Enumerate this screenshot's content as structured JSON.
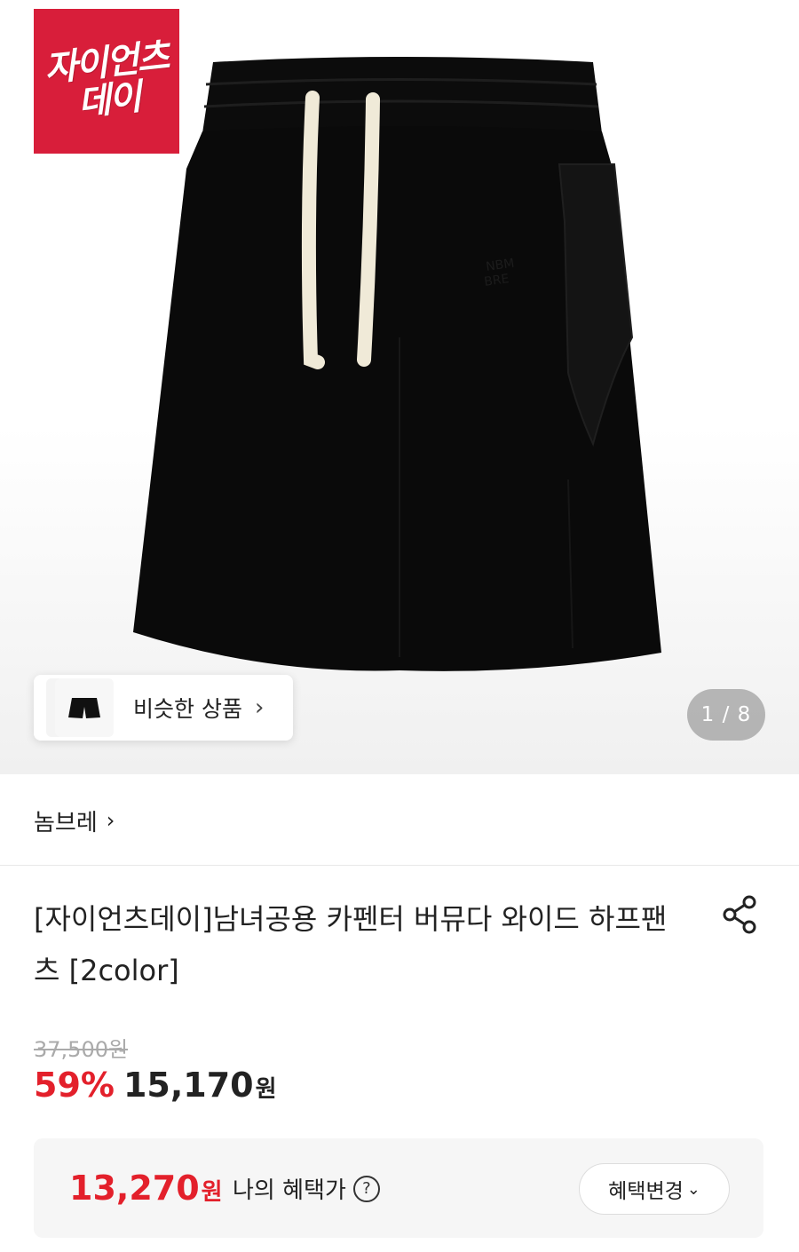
{
  "product_image": {
    "brand_logo_text": [
      "자이언츠",
      "데이"
    ],
    "similar_products_label": "비슷한 상품",
    "similar_chevron": "›",
    "pager": "1 / 8"
  },
  "brand": {
    "name": "놈브레",
    "chevron": "›"
  },
  "product": {
    "title": "[자이언츠데이]남녀공용 카펜터 버뮤다 와이드 하프팬츠 [2color]",
    "share_icon": "share-icon"
  },
  "pricing": {
    "original_price": "37,500원",
    "discount_rate": "59%",
    "sale_price": "15,170",
    "currency": "원",
    "accent_color": "#e3202b"
  },
  "benefit": {
    "price": "13,270",
    "currency": "원",
    "label": "나의 혜택가",
    "help_icon": "?",
    "change_button": "혜택변경",
    "change_chevron": "⌄"
  }
}
